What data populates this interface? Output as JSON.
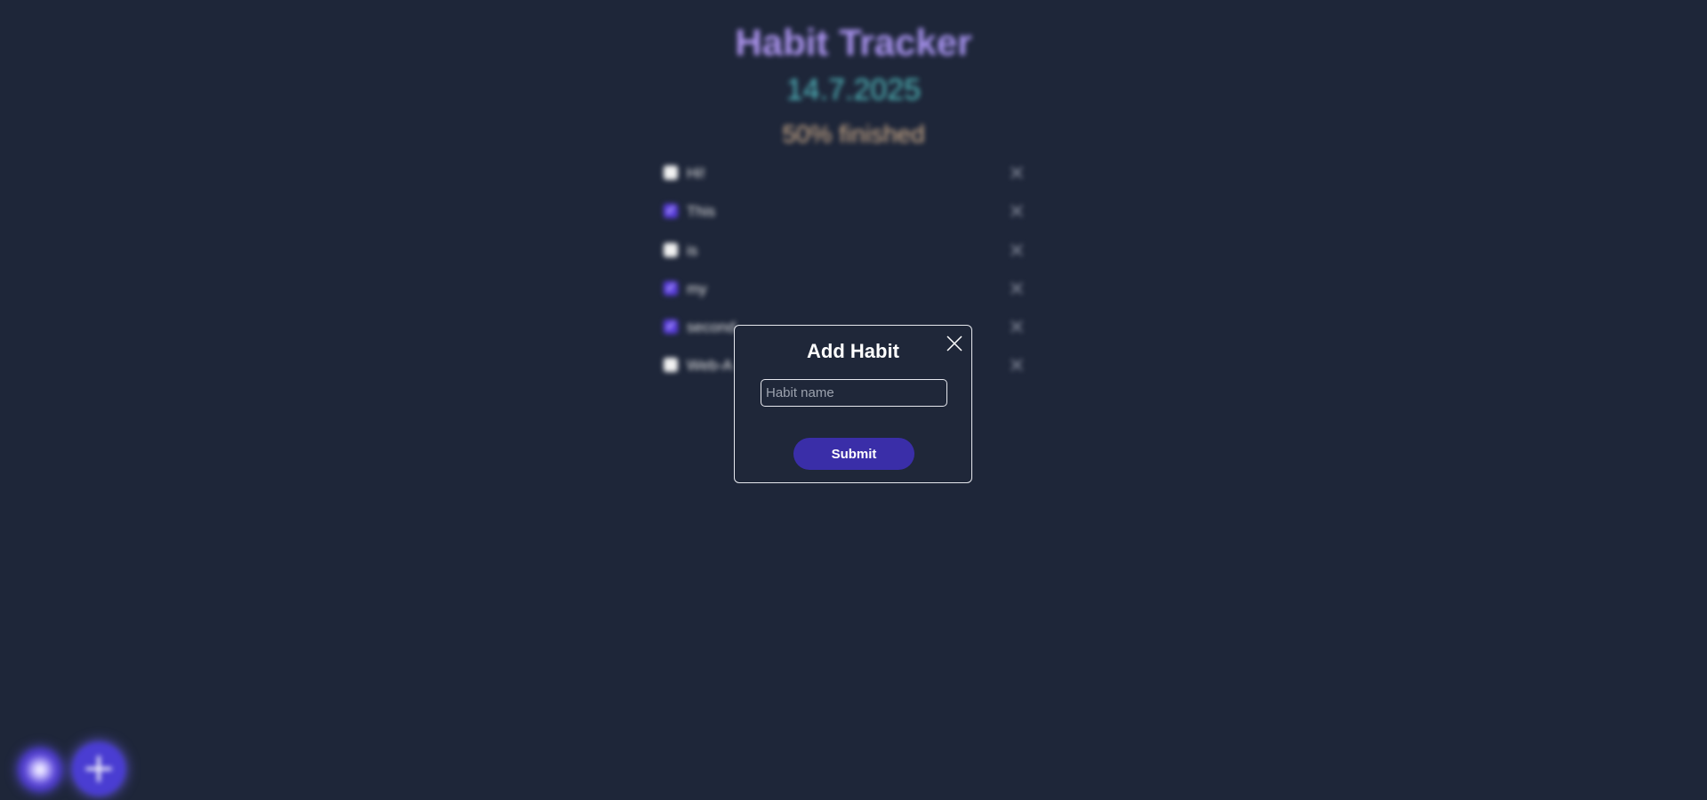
{
  "app": {
    "title": "Habit Tracker",
    "date": "14.7.2025",
    "progress_text": "50% finished"
  },
  "habits": [
    {
      "name": "Hi!",
      "done": false
    },
    {
      "name": "This",
      "done": true
    },
    {
      "name": "is",
      "done": false
    },
    {
      "name": "my",
      "done": true
    },
    {
      "name": "second",
      "done": true
    },
    {
      "name": "Web-A",
      "done": false
    }
  ],
  "modal": {
    "title": "Add Habit",
    "input_placeholder": "Habit name",
    "input_value": "",
    "submit_label": "Submit"
  },
  "icons": {
    "close": "close-icon",
    "delete": "x-icon",
    "theme": "sun-icon",
    "add": "plus-icon"
  },
  "colors": {
    "background": "#1e2639",
    "accent": "#3a2ea8",
    "checked": "#5b3ee0"
  }
}
